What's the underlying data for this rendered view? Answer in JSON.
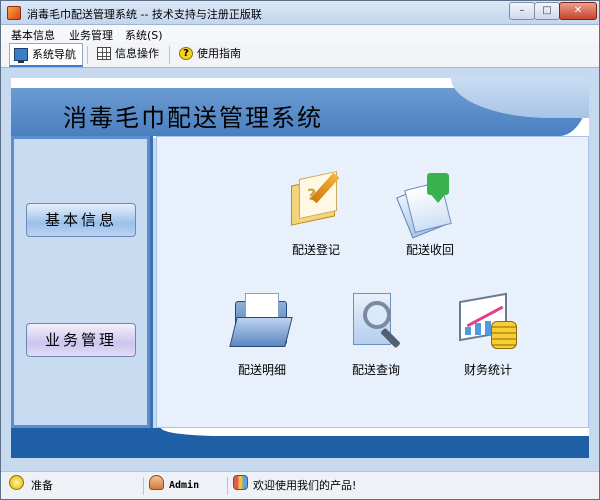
{
  "window": {
    "title": "消毒毛巾配送管理系统 -- 技术支持与注册正版联系(",
    "buttons": {
      "minimize": "–",
      "maximize": "□",
      "close": "✕"
    }
  },
  "menu": [
    "基本信息",
    "业务管理",
    "系统(S)"
  ],
  "tabs": [
    {
      "label": "系统导航",
      "icon": "monitor-icon",
      "active": true
    },
    {
      "label": "信息操作",
      "icon": "grid-icon",
      "active": false
    },
    {
      "label": "使用指南",
      "icon": "help-icon",
      "active": false
    }
  ],
  "banner": {
    "title": "消毒毛巾配送管理系统"
  },
  "sidebar": {
    "buttons": [
      "基本信息",
      "业务管理"
    ]
  },
  "features": [
    {
      "label": "配送登记",
      "icon": "register-book-icon"
    },
    {
      "label": "配送收回",
      "icon": "receive-download-icon"
    },
    {
      "label": "配送明细",
      "icon": "detail-folder-icon"
    },
    {
      "label": "配送查询",
      "icon": "search-magnifier-icon"
    },
    {
      "label": "财务统计",
      "icon": "finance-chart-icon"
    }
  ],
  "status": {
    "state": "准备",
    "user": "Admin",
    "message": "欢迎使用我们的产品!"
  },
  "colors": {
    "banner": "#4a7fc0",
    "sidebar": "#5d8ccf",
    "bottom_band": "#1f5fa5",
    "panel": "#e7f0fb"
  }
}
